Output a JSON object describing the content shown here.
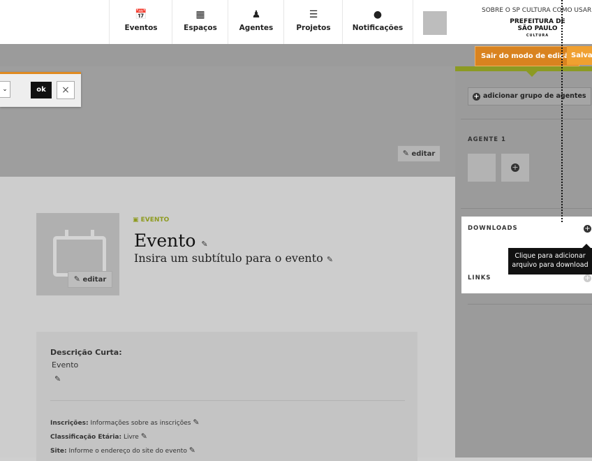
{
  "nav": {
    "items": [
      {
        "label": "Eventos",
        "icon": "calendar-icon"
      },
      {
        "label": "Espaços",
        "icon": "building-icon"
      },
      {
        "label": "Agentes",
        "icon": "person-icon"
      },
      {
        "label": "Projetos",
        "icon": "document-icon"
      },
      {
        "label": "Notificações",
        "icon": "speech-bubble-icon"
      }
    ],
    "toplinks": "SOBRE O SP CULTURA   COMO USAR",
    "logo_line1": "PREFEITURA DE",
    "logo_line2": "SÃO PAULO",
    "logo_line3": "CULTURA"
  },
  "editbar": {
    "exit_label": "Sair do modo de edição",
    "save_label": "Salvar"
  },
  "cover": {
    "ok_label": "ok",
    "close_label": "×",
    "edit_label": "editar"
  },
  "event": {
    "type_label": "EVENTO",
    "title": "Evento",
    "subtitle": "Insira um subtítulo para o evento",
    "thumb_edit_label": "editar",
    "desc_label": "Descrição Curta:",
    "desc_value": "Evento",
    "info": [
      {
        "label": "Inscrições:",
        "value": "Informações sobre as inscrições"
      },
      {
        "label": "Classificação Etária:",
        "value": "Livre"
      },
      {
        "label": "Site:",
        "value": "Informe o endereço do site do evento"
      }
    ]
  },
  "sidebar": {
    "add_group_label": "adicionar grupo de agentes",
    "agent_label": "AGENTE 1",
    "downloads_label": "DOWNLOADS",
    "links_label": "LINKS",
    "tooltip_line1": "Clique para adicionar",
    "tooltip_line2": "arquivo para download"
  }
}
